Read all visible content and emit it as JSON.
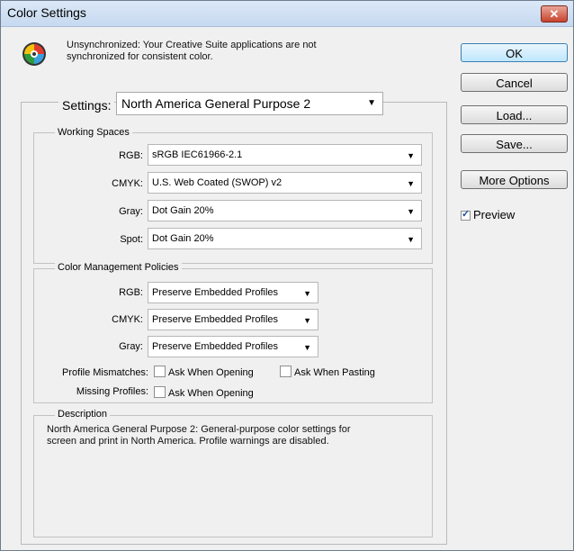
{
  "window": {
    "title": "Color Settings",
    "close_icon": "close-icon"
  },
  "sync": {
    "icon": "color-wheel-icon",
    "message_line1": "Unsynchronized: Your Creative Suite applications are not",
    "message_line2": "synchronized for consistent color."
  },
  "buttons": {
    "ok": "OK",
    "cancel": "Cancel",
    "load": "Load...",
    "save": "Save...",
    "more_options": "More Options"
  },
  "preview": {
    "label": "Preview",
    "checked": true
  },
  "settings": {
    "label": "Settings:",
    "value": "North America General Purpose 2"
  },
  "working_spaces": {
    "title": "Working Spaces",
    "rgb_label": "RGB:",
    "rgb_value": "sRGB IEC61966-2.1",
    "cmyk_label": "CMYK:",
    "cmyk_value": "U.S. Web Coated (SWOP) v2",
    "gray_label": "Gray:",
    "gray_value": "Dot Gain 20%",
    "spot_label": "Spot:",
    "spot_value": "Dot Gain 20%"
  },
  "policies": {
    "title": "Color Management Policies",
    "rgb_label": "RGB:",
    "rgb_value": "Preserve Embedded Profiles",
    "cmyk_label": "CMYK:",
    "cmyk_value": "Preserve Embedded Profiles",
    "gray_label": "Gray:",
    "gray_value": "Preserve Embedded Profiles",
    "mismatch_label": "Profile Mismatches:",
    "mismatch_opening": "Ask When Opening",
    "mismatch_pasting": "Ask When Pasting",
    "missing_label": "Missing Profiles:",
    "missing_opening": "Ask When Opening"
  },
  "description": {
    "title": "Description",
    "line1": "North America General Purpose 2:  General-purpose color settings for",
    "line2": "screen and print in North America. Profile warnings are disabled."
  }
}
